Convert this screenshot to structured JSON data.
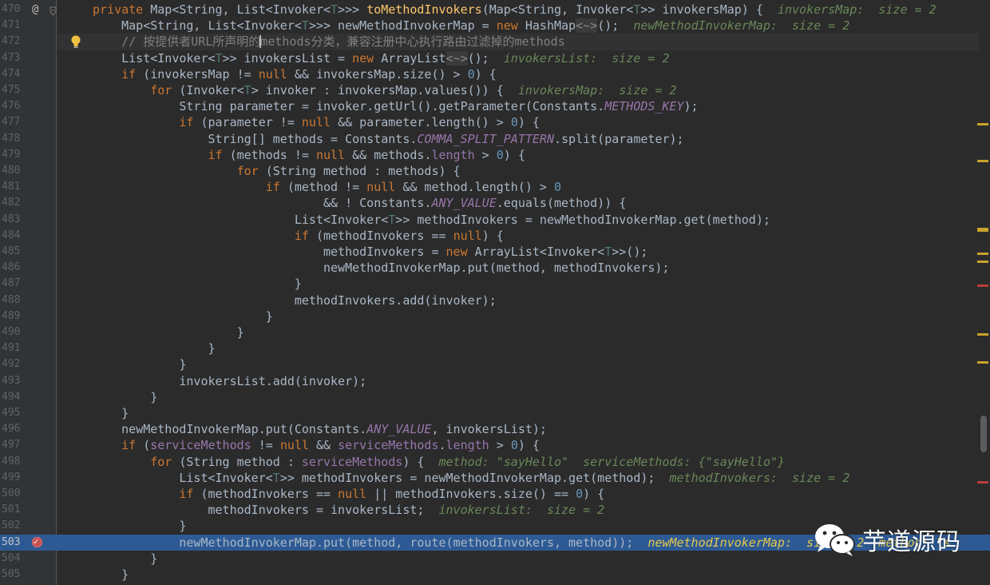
{
  "editor": {
    "lines": [
      {
        "no": "470",
        "tokens": [
          [
            "kw",
            "private "
          ],
          [
            "typ",
            "Map<String, List<Invoker<"
          ],
          [
            "tp",
            "T"
          ],
          [
            "typ",
            ">>> "
          ],
          [
            "fn",
            "toMethodInvokers"
          ],
          [
            "typ",
            "(Map<String, Invoker<"
          ],
          [
            "tp",
            "T"
          ],
          [
            "typ",
            ">> invokersMap) {  "
          ],
          [
            "hint",
            "invokersMap:  size = 2"
          ]
        ]
      },
      {
        "no": "471",
        "tokens": [
          [
            "typ",
            "    Map<String, List<Invoker<"
          ],
          [
            "tp",
            "T"
          ],
          [
            "typ",
            ">>> newMethodInvokerMap = "
          ],
          [
            "kw",
            "new "
          ],
          [
            "typ",
            "HashMap"
          ],
          [
            "fold",
            "<~>"
          ],
          [
            "typ",
            "();  "
          ],
          [
            "hint",
            "newMethodInvokerMap:  size = 2"
          ]
        ]
      },
      {
        "no": "472",
        "tokens": [
          [
            "cmt",
            "    // 按提供者URL所声明的methods分类，兼容注册中心执行路由过滤掉的methods"
          ]
        ]
      },
      {
        "no": "473",
        "tokens": [
          [
            "typ",
            "    List<Invoker<"
          ],
          [
            "tp",
            "T"
          ],
          [
            "typ",
            ">> invokersList = "
          ],
          [
            "kw",
            "new "
          ],
          [
            "typ",
            "ArrayList"
          ],
          [
            "fold",
            "<~>"
          ],
          [
            "typ",
            "();  "
          ],
          [
            "hint",
            "invokersList:  size = 2"
          ]
        ]
      },
      {
        "no": "474",
        "tokens": [
          [
            "kw",
            "    if "
          ],
          [
            "typ",
            "(invokersMap != "
          ],
          [
            "kw",
            "null "
          ],
          [
            "typ",
            "&& invokersMap.size() > "
          ],
          [
            "num",
            "0"
          ],
          [
            "typ",
            ") {"
          ]
        ]
      },
      {
        "no": "475",
        "tokens": [
          [
            "kw",
            "        for "
          ],
          [
            "typ",
            "(Invoker<"
          ],
          [
            "tp",
            "T"
          ],
          [
            "typ",
            "> invoker : invokersMap.values()) {  "
          ],
          [
            "hint",
            "invokersMap:  size = 2"
          ]
        ]
      },
      {
        "no": "476",
        "tokens": [
          [
            "typ",
            "            String parameter = invoker.getUrl().getParameter(Constants."
          ],
          [
            "cst",
            "METHODS_KEY"
          ],
          [
            "typ",
            ");"
          ]
        ]
      },
      {
        "no": "477",
        "tokens": [
          [
            "kw",
            "            if "
          ],
          [
            "typ",
            "(parameter != "
          ],
          [
            "kw",
            "null "
          ],
          [
            "typ",
            "&& parameter.length() > "
          ],
          [
            "num",
            "0"
          ],
          [
            "typ",
            ") {"
          ]
        ]
      },
      {
        "no": "478",
        "tokens": [
          [
            "typ",
            "                String[] methods = Constants."
          ],
          [
            "cst",
            "COMMA_SPLIT_PATTERN"
          ],
          [
            "typ",
            ".split(parameter);"
          ]
        ]
      },
      {
        "no": "479",
        "tokens": [
          [
            "kw",
            "                if "
          ],
          [
            "typ",
            "(methods != "
          ],
          [
            "kw",
            "null "
          ],
          [
            "typ",
            "&& methods."
          ],
          [
            "fld",
            "length"
          ],
          [
            "typ",
            " > "
          ],
          [
            "num",
            "0"
          ],
          [
            "typ",
            ") {"
          ]
        ]
      },
      {
        "no": "480",
        "tokens": [
          [
            "kw",
            "                    for "
          ],
          [
            "typ",
            "(String method : methods) {"
          ]
        ]
      },
      {
        "no": "481",
        "tokens": [
          [
            "kw",
            "                        if "
          ],
          [
            "typ",
            "(method != "
          ],
          [
            "kw",
            "null "
          ],
          [
            "typ",
            "&& method.length() > "
          ],
          [
            "num",
            "0"
          ]
        ]
      },
      {
        "no": "482",
        "tokens": [
          [
            "typ",
            "                                && ! Constants."
          ],
          [
            "cst",
            "ANY_VALUE"
          ],
          [
            "typ",
            ".equals(method)) {"
          ]
        ]
      },
      {
        "no": "483",
        "tokens": [
          [
            "typ",
            "                            List<Invoker<"
          ],
          [
            "tp",
            "T"
          ],
          [
            "typ",
            ">> methodInvokers = newMethodInvokerMap.get(method);"
          ]
        ]
      },
      {
        "no": "484",
        "tokens": [
          [
            "kw",
            "                            if "
          ],
          [
            "typ",
            "(methodInvokers == "
          ],
          [
            "kw",
            "null"
          ],
          [
            "typ",
            ") {"
          ]
        ]
      },
      {
        "no": "485",
        "tokens": [
          [
            "typ",
            "                                methodInvokers = "
          ],
          [
            "kw",
            "new "
          ],
          [
            "typ",
            "ArrayList<Invoker<"
          ],
          [
            "tp",
            "T"
          ],
          [
            "typ",
            ">>();"
          ]
        ]
      },
      {
        "no": "486",
        "tokens": [
          [
            "typ",
            "                                newMethodInvokerMap.put(method, methodInvokers);"
          ]
        ]
      },
      {
        "no": "487",
        "tokens": [
          [
            "typ",
            "                            }"
          ]
        ]
      },
      {
        "no": "488",
        "tokens": [
          [
            "typ",
            "                            methodInvokers.add(invoker);"
          ]
        ]
      },
      {
        "no": "489",
        "tokens": [
          [
            "typ",
            "                        }"
          ]
        ]
      },
      {
        "no": "490",
        "tokens": [
          [
            "typ",
            "                    }"
          ]
        ]
      },
      {
        "no": "491",
        "tokens": [
          [
            "typ",
            "                }"
          ]
        ]
      },
      {
        "no": "492",
        "tokens": [
          [
            "typ",
            "            }"
          ]
        ]
      },
      {
        "no": "493",
        "tokens": [
          [
            "typ",
            "            invokersList.add(invoker);"
          ]
        ]
      },
      {
        "no": "494",
        "tokens": [
          [
            "typ",
            "        }"
          ]
        ]
      },
      {
        "no": "495",
        "tokens": [
          [
            "typ",
            "    }"
          ]
        ]
      },
      {
        "no": "496",
        "tokens": [
          [
            "typ",
            "    newMethodInvokerMap.put(Constants."
          ],
          [
            "cst",
            "ANY_VALUE"
          ],
          [
            "typ",
            ", invokersList);"
          ]
        ]
      },
      {
        "no": "497",
        "tokens": [
          [
            "kw",
            "    if "
          ],
          [
            "typ",
            "("
          ],
          [
            "fld",
            "serviceMethods"
          ],
          [
            "typ",
            " != "
          ],
          [
            "kw",
            "null "
          ],
          [
            "typ",
            "&& "
          ],
          [
            "fld",
            "serviceMethods"
          ],
          [
            "typ",
            "."
          ],
          [
            "fld",
            "length"
          ],
          [
            "typ",
            " > "
          ],
          [
            "num",
            "0"
          ],
          [
            "typ",
            ") {"
          ]
        ]
      },
      {
        "no": "498",
        "tokens": [
          [
            "kw",
            "        for "
          ],
          [
            "typ",
            "(String method : "
          ],
          [
            "fld",
            "serviceMethods"
          ],
          [
            "typ",
            ") {  "
          ],
          [
            "hint",
            "method: \"sayHello\"  serviceMethods: {\"sayHello\"}"
          ]
        ]
      },
      {
        "no": "499",
        "tokens": [
          [
            "typ",
            "            List<Invoker<"
          ],
          [
            "tp",
            "T"
          ],
          [
            "typ",
            ">> methodInvokers = newMethodInvokerMap.get(method);  "
          ],
          [
            "hint",
            "methodInvokers:  size = 2"
          ]
        ]
      },
      {
        "no": "500",
        "tokens": [
          [
            "kw",
            "            if "
          ],
          [
            "typ",
            "(methodInvokers == "
          ],
          [
            "kw",
            "null "
          ],
          [
            "typ",
            "|| methodInvokers.size() == "
          ],
          [
            "num",
            "0"
          ],
          [
            "typ",
            ") {"
          ]
        ]
      },
      {
        "no": "501",
        "tokens": [
          [
            "typ",
            "                methodInvokers = invokersList;  "
          ],
          [
            "hint",
            "invokersList:  size = 2"
          ]
        ]
      },
      {
        "no": "502",
        "tokens": [
          [
            "typ",
            "            }"
          ]
        ]
      },
      {
        "no": "503",
        "tokens": [
          [
            "typ",
            "            newMethodInvokerMap.put(method, route(methodInvokers, method));  "
          ],
          [
            "hint-hl",
            "newMethodInvokerMap:  size = 2  method: \"s"
          ]
        ]
      },
      {
        "no": "504",
        "tokens": [
          [
            "typ",
            "        }"
          ]
        ]
      },
      {
        "no": "505",
        "tokens": [
          [
            "typ",
            "    }"
          ]
        ]
      }
    ]
  },
  "watermark": {
    "text": "芋道源码",
    "icon": "wechat-icon"
  },
  "colors": {
    "background": "#2b2b2b",
    "gutter": "#313335",
    "keyword": "#cc7832",
    "method": "#ffc66d",
    "number": "#6897bb",
    "constant": "#9876aa",
    "hint": "#6a8759",
    "execution_line": "#2d5a94"
  }
}
